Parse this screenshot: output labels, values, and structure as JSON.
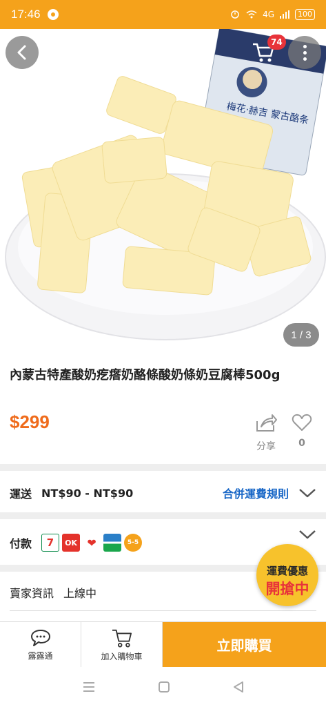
{
  "status_bar": {
    "time": "17:46",
    "network": "4G",
    "battery": "100"
  },
  "gallery": {
    "counter": "1 / 3",
    "package_text": "梅花·赫吉 蒙古酪条"
  },
  "cart": {
    "badge": "74"
  },
  "product": {
    "title": "內蒙古特產酸奶疙瘩奶酪條酸奶條奶豆腐棒500g",
    "price": "$299",
    "share_label": "分享",
    "like_count": "0"
  },
  "shipping": {
    "label": "運送",
    "value": "NT$90 - NT$90",
    "link": "合併運費規則"
  },
  "payment": {
    "label": "付款",
    "methods": [
      "7-ELEVEN",
      "OK",
      "萊爾富",
      "FamilyMart",
      "5-5"
    ]
  },
  "promo": {
    "line1": "運費優惠",
    "line2": "開搶中"
  },
  "seller": {
    "label": "賣家資訊",
    "status": "上線中"
  },
  "bottom_bar": {
    "chat_label": "露露通",
    "cart_label": "加入購物車",
    "buy_label": "立即購買"
  },
  "colors": {
    "brand": "#f5a21b",
    "price": "#ef6b1b",
    "link": "#1967c7",
    "badge": "#e8333a"
  }
}
